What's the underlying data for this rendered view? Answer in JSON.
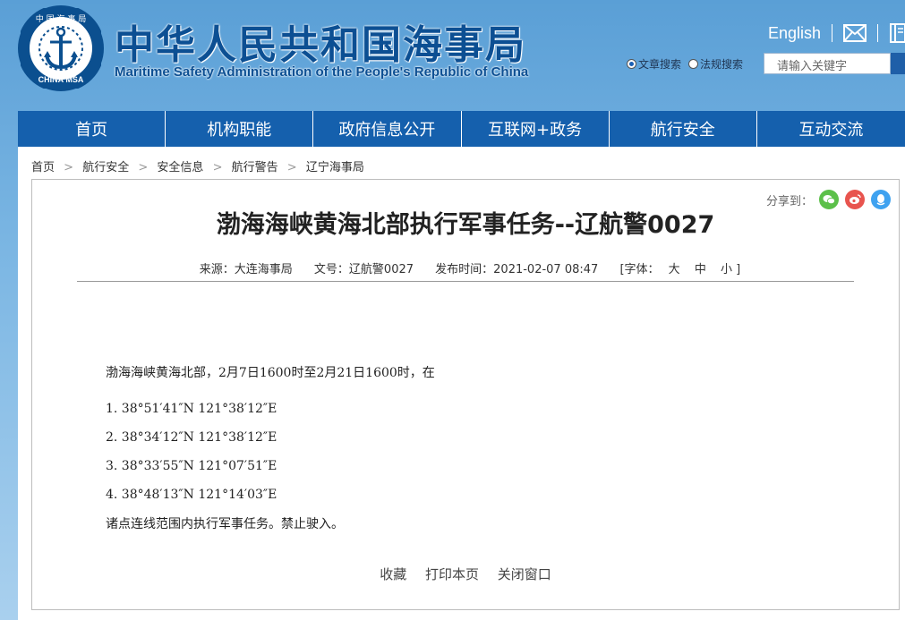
{
  "header": {
    "logo": {
      "ring_text_top": "中 国 海 事 局",
      "ring_text_bottom": "CHINA MSA"
    },
    "title_cn": "中华人民共和国海事局",
    "title_en": "Maritime Safety Administration of the People's Republic of China",
    "english_link": "English",
    "icons": [
      "mail-icon",
      "book-icon"
    ],
    "search": {
      "options": [
        "文章搜索",
        "法规搜索"
      ],
      "selected": "文章搜索",
      "placeholder": "请输入关键字"
    }
  },
  "nav": {
    "items": [
      "首页",
      "机构职能",
      "政府信息公开",
      "互联网+政务",
      "航行安全",
      "互动交流"
    ]
  },
  "breadcrumb": [
    "首页",
    "航行安全",
    "安全信息",
    "航行警告",
    "辽宁海事局"
  ],
  "article": {
    "share_label": "分享到：",
    "share_icons": [
      "wechat-icon",
      "weibo-icon",
      "qq-icon"
    ],
    "title": "渤海海峡黄海北部执行军事任务--辽航警0027",
    "meta": {
      "source": "来源：大连海事局",
      "doc_no": "文号：辽航警0027",
      "published": "发布时间：2021-02-07 08:47",
      "font_label": "[字体：",
      "font_sizes": [
        "大",
        "中",
        "小"
      ],
      "font_end": "]"
    },
    "intro": "渤海海峡黄海北部，2月7日1600时至2月21日1600时，在",
    "points": [
      "1. 38°51′41″N  121°38′12″E",
      "2. 38°34′12″N  121°38′12″E",
      "3. 38°33′55″N  121°07′51″E",
      "4. 38°48′13″N  121°14′03″E"
    ],
    "closing": "诸点连线范围内执行军事任务。禁止驶入。",
    "footer_links": [
      "收藏",
      "打印本页",
      "关闭窗口"
    ]
  },
  "colors": {
    "nav_bg": "#1560ad",
    "title_blue": "#0c4f93",
    "wechat": "#5cc04a",
    "weibo": "#e8544e",
    "qq": "#3fa2f0"
  }
}
